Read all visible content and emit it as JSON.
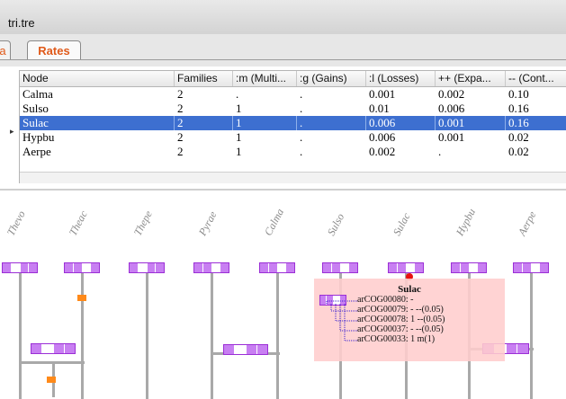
{
  "window": {
    "title": "tri.tre"
  },
  "tabs": [
    {
      "label": "a"
    },
    {
      "label": "Rates"
    }
  ],
  "table": {
    "columns": [
      "Node",
      "Families",
      ":m (Multi...",
      ":g (Gains)",
      ":l (Losses)",
      "++ (Expa...",
      "-- (Cont..."
    ],
    "rows": [
      [
        "Calma",
        "2",
        ".",
        ".",
        "0.001",
        "0.002",
        "0.10"
      ],
      [
        "Sulso",
        "2",
        "1",
        ".",
        "0.01",
        "0.006",
        "0.16"
      ],
      [
        "Sulac",
        "2",
        "1",
        ".",
        "0.006",
        "0.001",
        "0.16"
      ],
      [
        "Hypbu",
        "2",
        "1",
        ".",
        "0.006",
        "0.001",
        "0.02"
      ],
      [
        "Aerpe",
        "2",
        "1",
        ".",
        "0.002",
        ".",
        "0.02"
      ]
    ],
    "selected_row": 2,
    "row_marker": "▸"
  },
  "tree": {
    "tips": [
      "Thevo",
      "Theac",
      "Thepe",
      "Pyrae",
      "Calma",
      "Sulso",
      "Sulac",
      "Hypbu",
      "Aerpe"
    ]
  },
  "tooltip": {
    "title": "Sulac",
    "lines": [
      "arCOG00080: -",
      "arCOG00079: - --(0.05)",
      "arCOG00078: 1 --(0.05)",
      "arCOG00037: - --(0.05)",
      "arCOG00033: 1 m(1)"
    ]
  },
  "colors": {
    "accent": "#e05a1a",
    "selection": "#3d6fd0",
    "profile": "#c87ff2",
    "marker": "#ff8a1a",
    "popup": "#ffcdcd"
  }
}
